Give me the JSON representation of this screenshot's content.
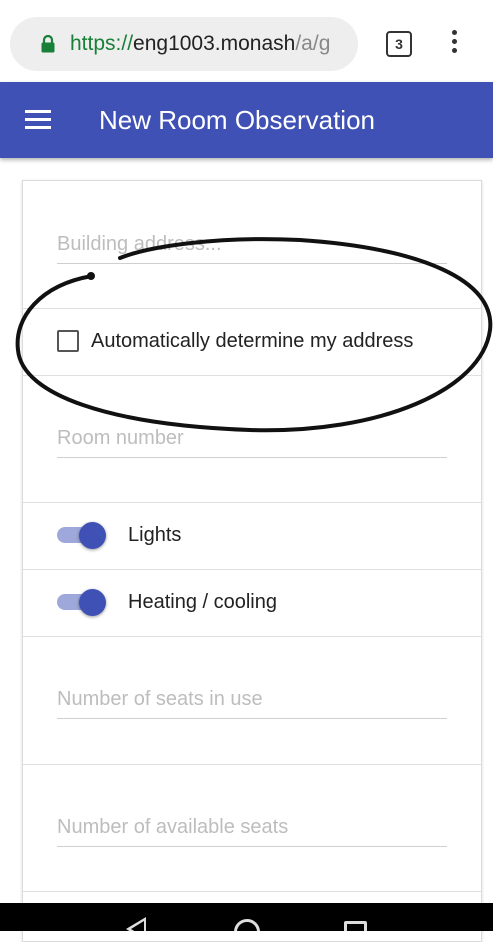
{
  "browser": {
    "url_scheme": "https://",
    "url_host": "eng1003.monash",
    "url_path": "/a/g",
    "tab_count": "3"
  },
  "app_bar": {
    "title": "New Room Observation"
  },
  "form": {
    "building_address_placeholder": "Building address...",
    "auto_address_label": "Automatically determine my address",
    "auto_address_checked": false,
    "room_number_placeholder": "Room number",
    "lights_label": "Lights",
    "lights_on": true,
    "heating_label": "Heating / cooling",
    "heating_on": true,
    "seats_in_use_placeholder": "Number of seats in use",
    "available_seats_placeholder": "Number of available seats"
  },
  "colors": {
    "primary": "#3f51b5",
    "switch_track": "#9fa8da",
    "url_secure": "#188038"
  }
}
